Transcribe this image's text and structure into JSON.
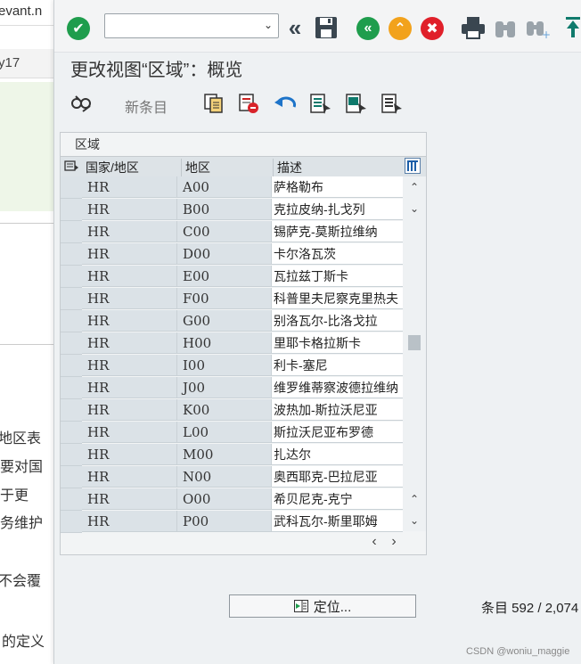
{
  "background_page": {
    "url_fragment": "evant.n",
    "tab_fragment": "y17",
    "text_lines": [
      "地区表",
      "要对国",
      "于更",
      "务维护",
      "不会覆",
      "的定义"
    ]
  },
  "toolbar": {
    "command_field_value": "",
    "icons": [
      "enter-check-icon",
      "command-dropdown-icon",
      "collapse-double-left-icon",
      "save-icon",
      "back-icon",
      "exit-icon",
      "cancel-icon",
      "print-icon",
      "find-icon",
      "find-next-icon",
      "first-page-icon"
    ]
  },
  "title": "更改视图“区域”：概览",
  "app_toolbar": {
    "new_entries_label": "新条目",
    "icons": [
      "glasses-display-change-icon",
      "copy-as-icon",
      "delete-icon",
      "undo-change-icon",
      "select-all-icon",
      "select-block-icon",
      "deselect-all-icon"
    ]
  },
  "table": {
    "caption": "区域",
    "columns": [
      "国家/地区",
      "地区",
      "描述"
    ],
    "rows": [
      {
        "country": "HR",
        "region": "A00",
        "description": "萨格勒布"
      },
      {
        "country": "HR",
        "region": "B00",
        "description": "克拉皮纳-扎戈列"
      },
      {
        "country": "HR",
        "region": "C00",
        "description": "锡萨克-莫斯拉维纳"
      },
      {
        "country": "HR",
        "region": "D00",
        "description": "卡尔洛瓦茨"
      },
      {
        "country": "HR",
        "region": "E00",
        "description": "瓦拉兹丁斯卡"
      },
      {
        "country": "HR",
        "region": "F00",
        "description": "科普里夫尼察克里热夫"
      },
      {
        "country": "HR",
        "region": "G00",
        "description": "别洛瓦尔-比洛戈拉"
      },
      {
        "country": "HR",
        "region": "H00",
        "description": "里耶卡格拉斯卡"
      },
      {
        "country": "HR",
        "region": "I00",
        "description": "利卡-塞尼"
      },
      {
        "country": "HR",
        "region": "J00",
        "description": "维罗维蒂察波德拉维纳"
      },
      {
        "country": "HR",
        "region": "K00",
        "description": "波热加-斯拉沃尼亚"
      },
      {
        "country": "HR",
        "region": "L00",
        "description": "斯拉沃尼亚布罗德"
      },
      {
        "country": "HR",
        "region": "M00",
        "description": "扎达尔"
      },
      {
        "country": "HR",
        "region": "N00",
        "description": "奥西耶克-巴拉尼亚"
      },
      {
        "country": "HR",
        "region": "O00",
        "description": "希贝尼克-克宁"
      },
      {
        "country": "HR",
        "region": "P00",
        "description": "武科瓦尔-斯里耶姆"
      }
    ]
  },
  "footer": {
    "locate_label": "定位...",
    "entries_text": "条目 592 / 2,074"
  },
  "credit": "CSDN @woniu_maggie",
  "colors": {
    "green": "#1f9d4d",
    "orange": "#f2a21c",
    "red": "#e0202a",
    "teal": "#0f7a6c"
  }
}
